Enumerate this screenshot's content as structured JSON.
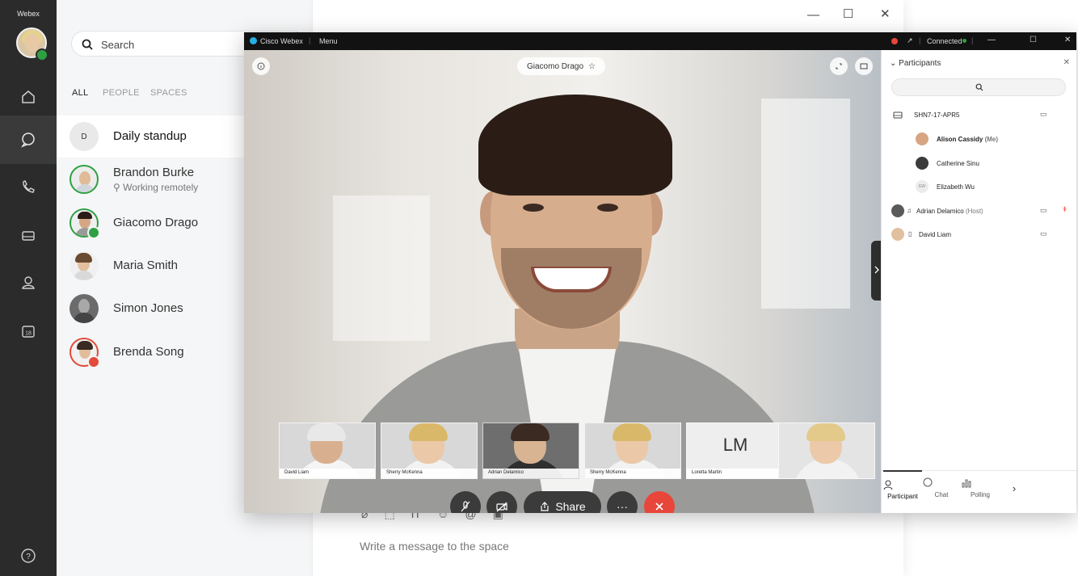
{
  "app": {
    "brand": "Webex"
  },
  "search": {
    "placeholder": "Search"
  },
  "filters": [
    "ALL",
    "PEOPLE",
    "SPACES"
  ],
  "list": {
    "items": [
      {
        "name": "Daily standup",
        "initial": "D",
        "subtitle": ""
      },
      {
        "name": "Brandon Burke",
        "initial": "",
        "subtitle": "Working remotely"
      },
      {
        "name": "Giacomo Drago",
        "initial": "",
        "subtitle": ""
      },
      {
        "name": "Maria Smith",
        "initial": "",
        "subtitle": ""
      },
      {
        "name": "Simon Jones",
        "initial": "",
        "subtitle": ""
      },
      {
        "name": "Brenda Song",
        "initial": "",
        "subtitle": ""
      }
    ]
  },
  "rail": {
    "calendar_day": "18"
  },
  "composer": {
    "placeholder": "Write a message to the space"
  },
  "meeting": {
    "titlebar": {
      "app_name": "Cisco Webex",
      "menu": "Menu",
      "status": "Connected"
    },
    "active_speaker": "Giacomo Drago",
    "thumbnails": [
      {
        "name": "David Liam",
        "initials": ""
      },
      {
        "name": "Sherry McKenna",
        "initials": ""
      },
      {
        "name": "Adrian Delamico",
        "initials": ""
      },
      {
        "name": "Sherry McKenna",
        "initials": ""
      },
      {
        "name": "Loretta Martin",
        "initials": "LM"
      },
      {
        "name": "",
        "initials": ""
      }
    ],
    "controls": {
      "share_label": "Share",
      "more_label": "···"
    }
  },
  "participants": {
    "header": "Participants",
    "device": "SHN7-17-APR5",
    "rows": [
      {
        "name": "Alison Cassidy",
        "suffix": "(Me)"
      },
      {
        "name": "Catherine Sinu",
        "suffix": ""
      },
      {
        "name": "Elizabeth Wu",
        "suffix": "",
        "initials": "EW"
      },
      {
        "name": "Adrian Delamico",
        "suffix": "(Host)"
      },
      {
        "name": "David Liam",
        "suffix": ""
      }
    ],
    "tabs": [
      "Participant",
      "Chat",
      "Polling"
    ]
  },
  "colors": {
    "rail_bg": "#2b2b2b",
    "presence_green": "#2ea043",
    "end_call_red": "#e8463b",
    "meeting_bar": "#121212"
  }
}
